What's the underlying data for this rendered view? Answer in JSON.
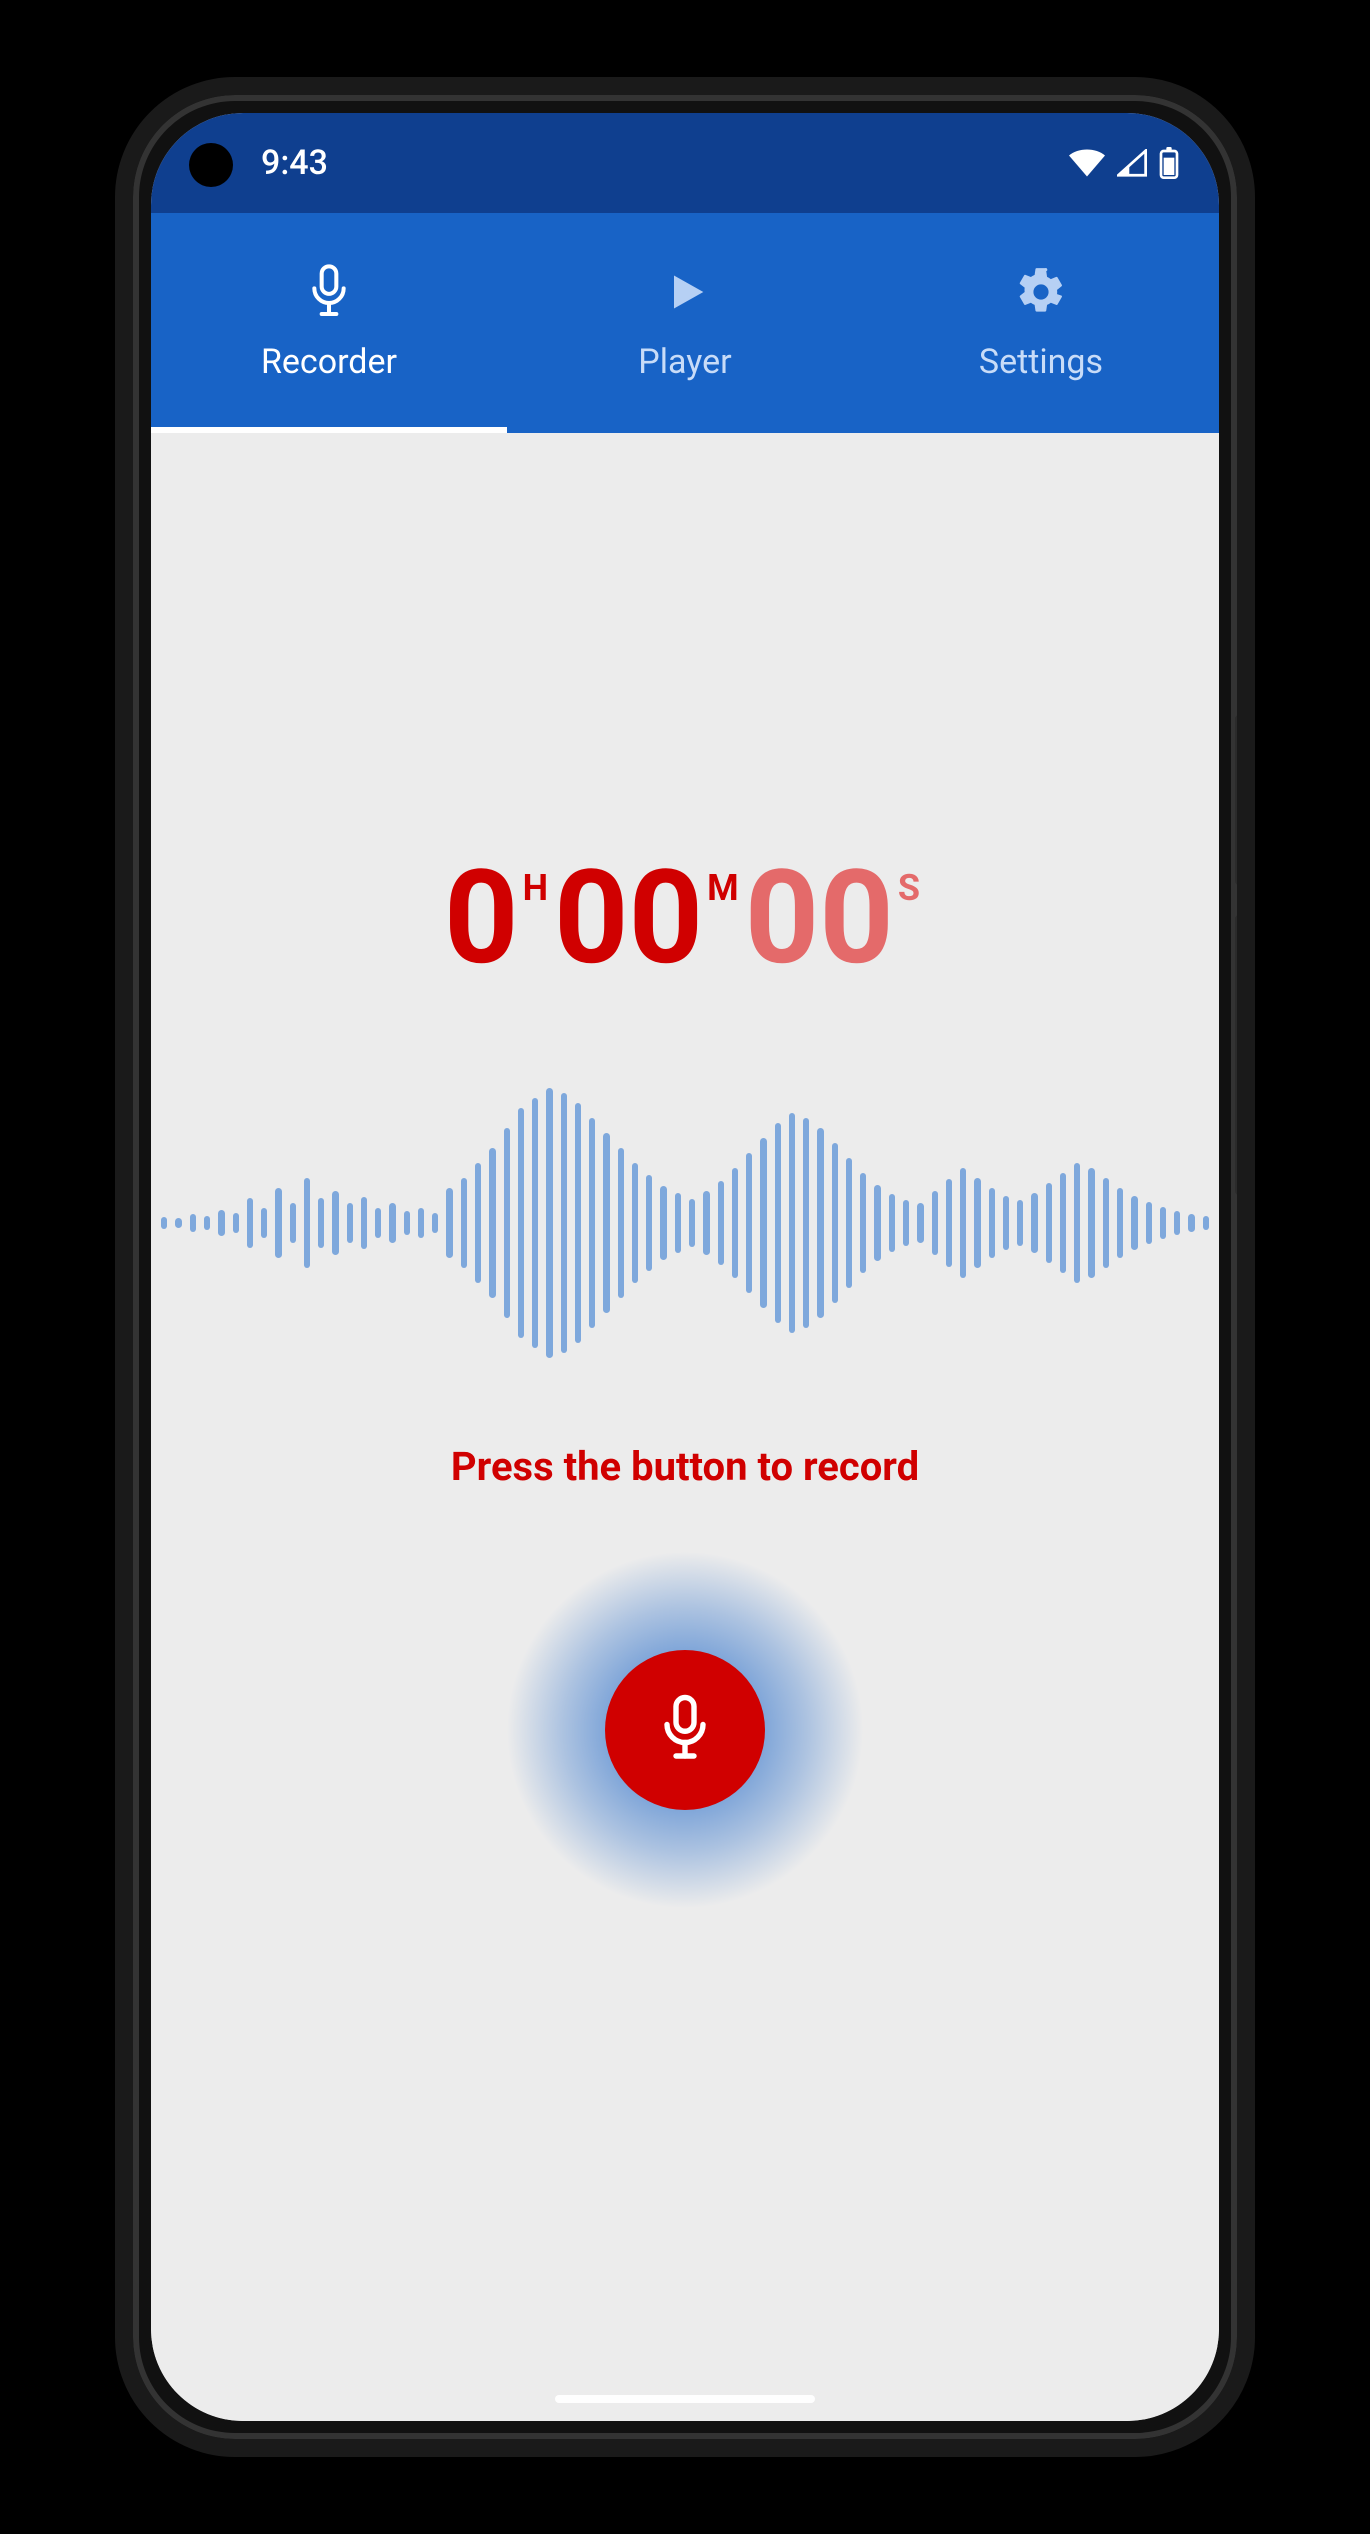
{
  "statusbar": {
    "time": "9:43"
  },
  "tabs": [
    {
      "label": "Recorder",
      "icon": "mic",
      "active": true
    },
    {
      "label": "Player",
      "icon": "play",
      "active": false
    },
    {
      "label": "Settings",
      "icon": "gear",
      "active": false
    }
  ],
  "timer": {
    "hours": "0",
    "hours_unit": "H",
    "minutes": "00",
    "minutes_unit": "M",
    "seconds": "00",
    "seconds_unit": "S"
  },
  "hint": "Press the button to record",
  "waveform_heights": [
    12,
    10,
    18,
    14,
    26,
    20,
    50,
    30,
    70,
    40,
    90,
    50,
    64,
    40,
    52,
    30,
    40,
    24,
    30,
    20,
    70,
    90,
    120,
    150,
    190,
    230,
    250,
    270,
    260,
    240,
    210,
    180,
    150,
    120,
    96,
    74,
    60,
    48,
    64,
    84,
    110,
    140,
    170,
    200,
    220,
    210,
    190,
    160,
    130,
    100,
    76,
    58,
    46,
    40,
    64,
    88,
    110,
    90,
    70,
    54,
    46,
    60,
    80,
    100,
    120,
    110,
    90,
    70,
    54,
    42,
    32,
    24,
    18,
    14
  ],
  "colors": {
    "tabbar": "#1863c6",
    "statusbar": "#0f3f8f",
    "accent_red": "#d00000",
    "seconds_red": "#e46a6a",
    "wave_blue": "#7ea8dc",
    "bg": "#ececec"
  }
}
